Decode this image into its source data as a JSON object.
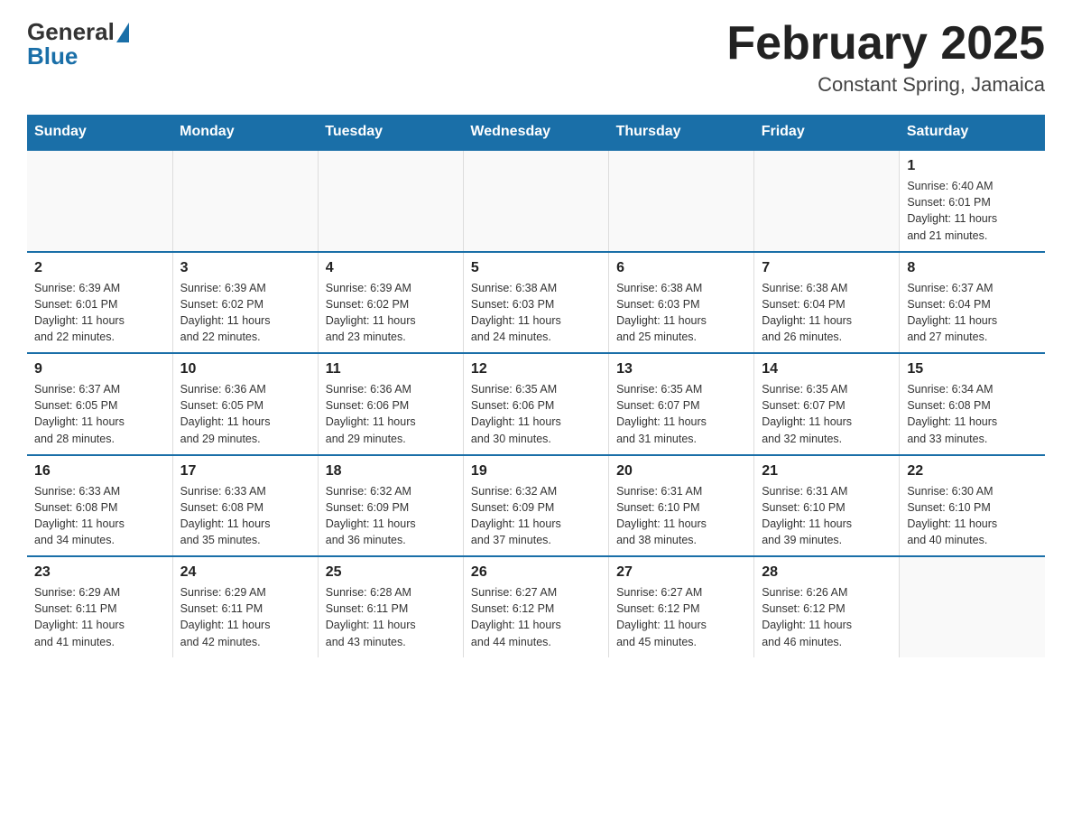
{
  "logo": {
    "general": "General",
    "blue": "Blue"
  },
  "title": "February 2025",
  "subtitle": "Constant Spring, Jamaica",
  "days_of_week": [
    "Sunday",
    "Monday",
    "Tuesday",
    "Wednesday",
    "Thursday",
    "Friday",
    "Saturday"
  ],
  "weeks": [
    [
      {
        "day": "",
        "info": ""
      },
      {
        "day": "",
        "info": ""
      },
      {
        "day": "",
        "info": ""
      },
      {
        "day": "",
        "info": ""
      },
      {
        "day": "",
        "info": ""
      },
      {
        "day": "",
        "info": ""
      },
      {
        "day": "1",
        "info": "Sunrise: 6:40 AM\nSunset: 6:01 PM\nDaylight: 11 hours\nand 21 minutes."
      }
    ],
    [
      {
        "day": "2",
        "info": "Sunrise: 6:39 AM\nSunset: 6:01 PM\nDaylight: 11 hours\nand 22 minutes."
      },
      {
        "day": "3",
        "info": "Sunrise: 6:39 AM\nSunset: 6:02 PM\nDaylight: 11 hours\nand 22 minutes."
      },
      {
        "day": "4",
        "info": "Sunrise: 6:39 AM\nSunset: 6:02 PM\nDaylight: 11 hours\nand 23 minutes."
      },
      {
        "day": "5",
        "info": "Sunrise: 6:38 AM\nSunset: 6:03 PM\nDaylight: 11 hours\nand 24 minutes."
      },
      {
        "day": "6",
        "info": "Sunrise: 6:38 AM\nSunset: 6:03 PM\nDaylight: 11 hours\nand 25 minutes."
      },
      {
        "day": "7",
        "info": "Sunrise: 6:38 AM\nSunset: 6:04 PM\nDaylight: 11 hours\nand 26 minutes."
      },
      {
        "day": "8",
        "info": "Sunrise: 6:37 AM\nSunset: 6:04 PM\nDaylight: 11 hours\nand 27 minutes."
      }
    ],
    [
      {
        "day": "9",
        "info": "Sunrise: 6:37 AM\nSunset: 6:05 PM\nDaylight: 11 hours\nand 28 minutes."
      },
      {
        "day": "10",
        "info": "Sunrise: 6:36 AM\nSunset: 6:05 PM\nDaylight: 11 hours\nand 29 minutes."
      },
      {
        "day": "11",
        "info": "Sunrise: 6:36 AM\nSunset: 6:06 PM\nDaylight: 11 hours\nand 29 minutes."
      },
      {
        "day": "12",
        "info": "Sunrise: 6:35 AM\nSunset: 6:06 PM\nDaylight: 11 hours\nand 30 minutes."
      },
      {
        "day": "13",
        "info": "Sunrise: 6:35 AM\nSunset: 6:07 PM\nDaylight: 11 hours\nand 31 minutes."
      },
      {
        "day": "14",
        "info": "Sunrise: 6:35 AM\nSunset: 6:07 PM\nDaylight: 11 hours\nand 32 minutes."
      },
      {
        "day": "15",
        "info": "Sunrise: 6:34 AM\nSunset: 6:08 PM\nDaylight: 11 hours\nand 33 minutes."
      }
    ],
    [
      {
        "day": "16",
        "info": "Sunrise: 6:33 AM\nSunset: 6:08 PM\nDaylight: 11 hours\nand 34 minutes."
      },
      {
        "day": "17",
        "info": "Sunrise: 6:33 AM\nSunset: 6:08 PM\nDaylight: 11 hours\nand 35 minutes."
      },
      {
        "day": "18",
        "info": "Sunrise: 6:32 AM\nSunset: 6:09 PM\nDaylight: 11 hours\nand 36 minutes."
      },
      {
        "day": "19",
        "info": "Sunrise: 6:32 AM\nSunset: 6:09 PM\nDaylight: 11 hours\nand 37 minutes."
      },
      {
        "day": "20",
        "info": "Sunrise: 6:31 AM\nSunset: 6:10 PM\nDaylight: 11 hours\nand 38 minutes."
      },
      {
        "day": "21",
        "info": "Sunrise: 6:31 AM\nSunset: 6:10 PM\nDaylight: 11 hours\nand 39 minutes."
      },
      {
        "day": "22",
        "info": "Sunrise: 6:30 AM\nSunset: 6:10 PM\nDaylight: 11 hours\nand 40 minutes."
      }
    ],
    [
      {
        "day": "23",
        "info": "Sunrise: 6:29 AM\nSunset: 6:11 PM\nDaylight: 11 hours\nand 41 minutes."
      },
      {
        "day": "24",
        "info": "Sunrise: 6:29 AM\nSunset: 6:11 PM\nDaylight: 11 hours\nand 42 minutes."
      },
      {
        "day": "25",
        "info": "Sunrise: 6:28 AM\nSunset: 6:11 PM\nDaylight: 11 hours\nand 43 minutes."
      },
      {
        "day": "26",
        "info": "Sunrise: 6:27 AM\nSunset: 6:12 PM\nDaylight: 11 hours\nand 44 minutes."
      },
      {
        "day": "27",
        "info": "Sunrise: 6:27 AM\nSunset: 6:12 PM\nDaylight: 11 hours\nand 45 minutes."
      },
      {
        "day": "28",
        "info": "Sunrise: 6:26 AM\nSunset: 6:12 PM\nDaylight: 11 hours\nand 46 minutes."
      },
      {
        "day": "",
        "info": ""
      }
    ]
  ]
}
